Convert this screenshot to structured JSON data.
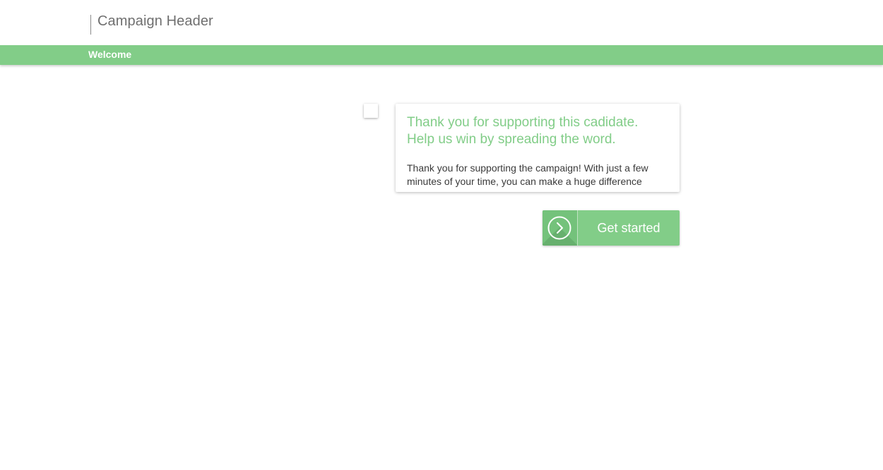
{
  "header": {
    "title": "Campaign Header"
  },
  "nav": {
    "welcome_label": "Welcome"
  },
  "card": {
    "heading_line1": "Thank you for supporting this cadidate.",
    "heading_line2": "Help us win by spreading the word.",
    "body_line1": "Thank you for supporting the campaign! With just a few",
    "body_line2": "minutes of your time, you can make a huge difference"
  },
  "cta": {
    "label": "Get started",
    "icon": "chevron-circle-right-icon"
  },
  "colors": {
    "accent": "#82cd88",
    "accent_dark": "#74c27b",
    "text": "#3a3a3a",
    "header_text": "#6f6f6f"
  }
}
